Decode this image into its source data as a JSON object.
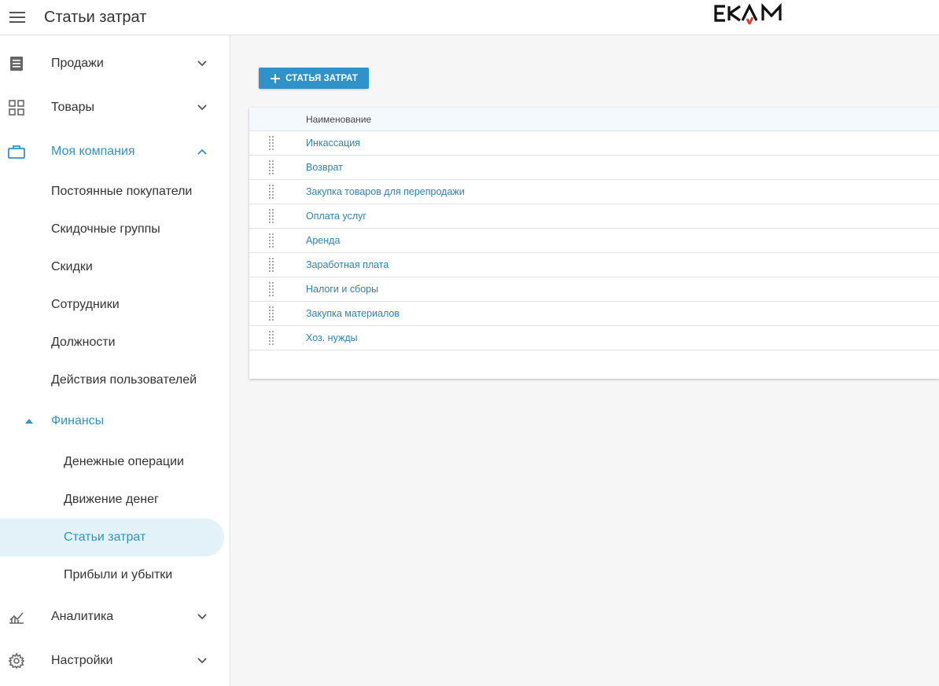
{
  "header": {
    "title": "Статьи затрат",
    "logo_text": "EKAM"
  },
  "sidebar": {
    "groups": [
      {
        "label": "Продажи",
        "icon": "receipt-icon"
      },
      {
        "label": "Товары",
        "icon": "grid-icon"
      },
      {
        "label": "Моя компания",
        "icon": "briefcase-icon"
      },
      {
        "label": "Аналитика",
        "icon": "analytics-icon"
      },
      {
        "label": "Настройки",
        "icon": "gear-icon"
      }
    ],
    "company_items": [
      "Постоянные покупатели",
      "Скидочные группы",
      "Скидки",
      "Сотрудники",
      "Должности",
      "Действия пользователей"
    ],
    "finance": {
      "label": "Финансы",
      "items": [
        "Денежные операции",
        "Движение денег",
        "Статьи затрат",
        "Прибыли и убытки"
      ]
    }
  },
  "main": {
    "add_button_label": "СТАТЬЯ ЗАТРАТ",
    "table": {
      "column_name": "Наименование",
      "rows": [
        "Инкассация",
        "Возврат",
        "Закупка товаров для перепродажи",
        "Оплата услуг",
        "Аренда",
        "Заработная плата",
        "Налоги и сборы",
        "Закупка материалов",
        "Хоз. нужды"
      ]
    }
  },
  "colors": {
    "accent": "#2f93c9",
    "link": "#2f82b6",
    "selected_bg": "#e3f1f8"
  }
}
